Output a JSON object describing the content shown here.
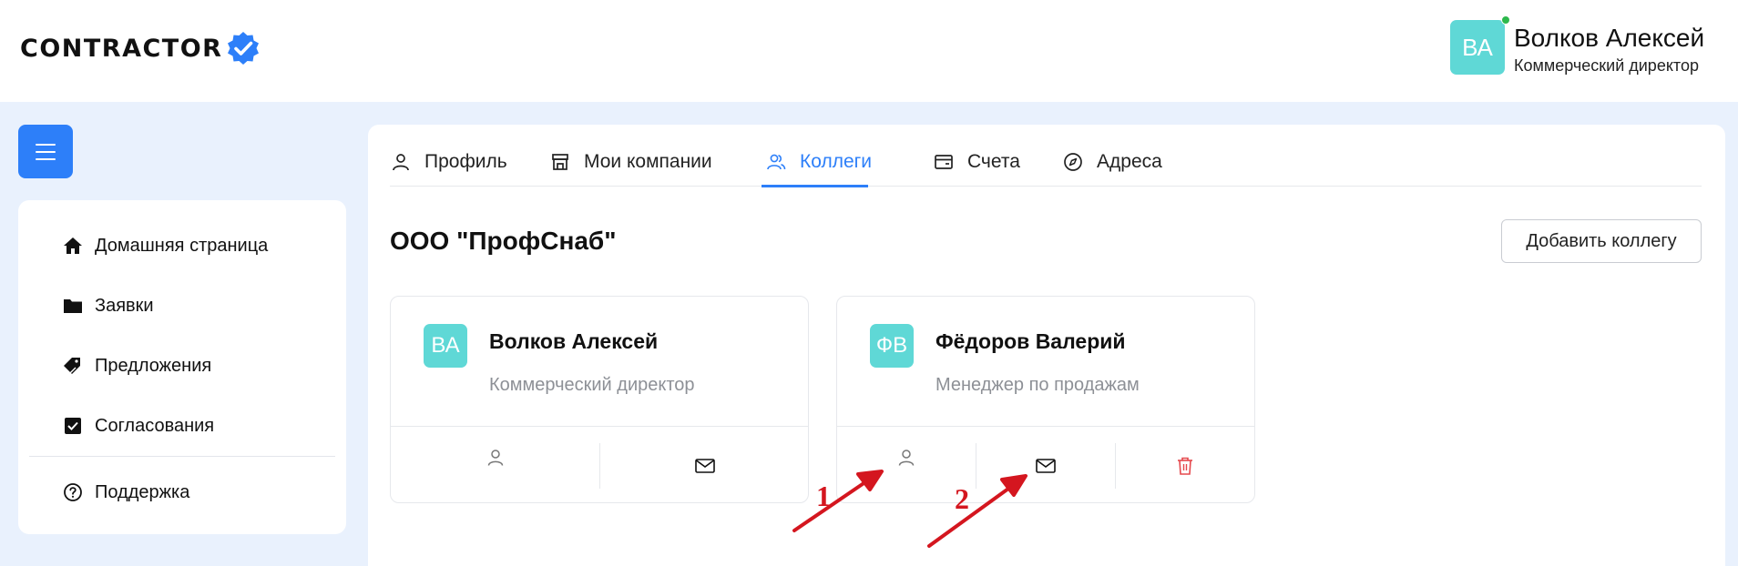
{
  "header": {
    "logo_text": "CONTRACTOR",
    "user": {
      "initials": "ВА",
      "name": "Волков Алексей",
      "role": "Коммерческий директор"
    }
  },
  "sidebar": {
    "items": [
      {
        "label": "Домашняя страница",
        "icon": "home-icon"
      },
      {
        "label": "Заявки",
        "icon": "folder-icon"
      },
      {
        "label": "Предложения",
        "icon": "tags-icon"
      },
      {
        "label": "Согласования",
        "icon": "checkbox-icon"
      },
      {
        "label": "Поддержка",
        "icon": "help-circle-icon"
      }
    ]
  },
  "tabs": [
    {
      "label": "Профиль",
      "icon": "user-icon"
    },
    {
      "label": "Мои компании",
      "icon": "store-icon"
    },
    {
      "label": "Коллеги",
      "icon": "users-icon",
      "active": true
    },
    {
      "label": "Счета",
      "icon": "wallet-icon"
    },
    {
      "label": "Адреса",
      "icon": "compass-icon"
    }
  ],
  "company": {
    "title": "ООО \"ПрофСнаб\"",
    "add_button": "Добавить коллегу"
  },
  "colleagues": [
    {
      "initials": "ВА",
      "name": "Волков Алексей",
      "role": "Коммерческий директор"
    },
    {
      "initials": "ФВ",
      "name": "Фёдоров Валерий",
      "role": "Менеджер по продажам"
    }
  ],
  "annotations": [
    "1",
    "2"
  ],
  "colors": {
    "accent": "#2d7ff9",
    "avatar": "#5fd8d6",
    "danger": "#e5484d",
    "annotation": "#d4161f",
    "page_bg": "#e9f1fd"
  }
}
